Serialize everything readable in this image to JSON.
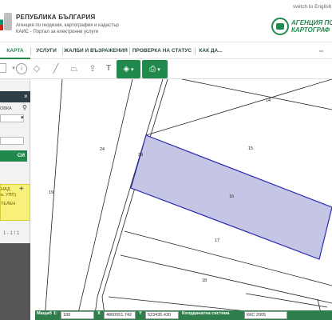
{
  "header": {
    "republic_title": "РЕПУБЛИКА БЪЛГАРИЯ",
    "agency_line": "Агенция по геодезия, картография и кадастър",
    "portal_line": "КАИС - Портал за електронни услуги",
    "switch_language": "switch to English",
    "agency_logo_line1": "АГЕНЦИЯ ПО",
    "agency_logo_line2": "КАРТОГРАФ"
  },
  "nav": {
    "items": [
      "КАРТА",
      "УСЛУГИ",
      "ЖАЛБИ И ВЪЗРАЖЕНИЯ",
      "ПРОВЕРКА НА СТАТУС",
      "КАК ДА..."
    ],
    "active_index": 0
  },
  "toolbar": {
    "icons": [
      "dropdown-arrow-icon",
      "info-icon",
      "layers-icon",
      "ruler-icon",
      "area-icon",
      "upload-icon",
      "text-icon",
      "layer-stack-icon",
      "print-icon"
    ],
    "layers_badge": "0"
  },
  "sidebar": {
    "field_label": "ОВКА",
    "search_button": "СИ",
    "result_lines": [
      "НАД",
      "в. УПП)",
      "ТЕЛЕН"
    ],
    "pager": "1 - 1 / 1"
  },
  "map": {
    "parcels": [
      {
        "label": "14"
      },
      {
        "label": "15"
      },
      {
        "label": "16",
        "highlighted": true
      },
      {
        "label": "17"
      },
      {
        "label": "18"
      },
      {
        "label": "24"
      },
      {
        "label": "19"
      },
      {
        "label": "29"
      },
      {
        "label": "20"
      }
    ],
    "highlight_color": "#c5c6e6",
    "highlight_stroke": "#2a2ab0"
  },
  "coordinates": {
    "scale_label": "Мащаб",
    "scale_prefix": "1:",
    "scale_value": "188",
    "x_label": "X",
    "x_value": "4860551.742",
    "y_label": "Y",
    "y_value": "523435.430",
    "system_label": "Координатна система",
    "system_value": "ККС 2005"
  },
  "colors": {
    "brand_green": "#1f8a4c",
    "dark_bar": "#2f3e46",
    "result_yellow": "#f7f07a"
  }
}
